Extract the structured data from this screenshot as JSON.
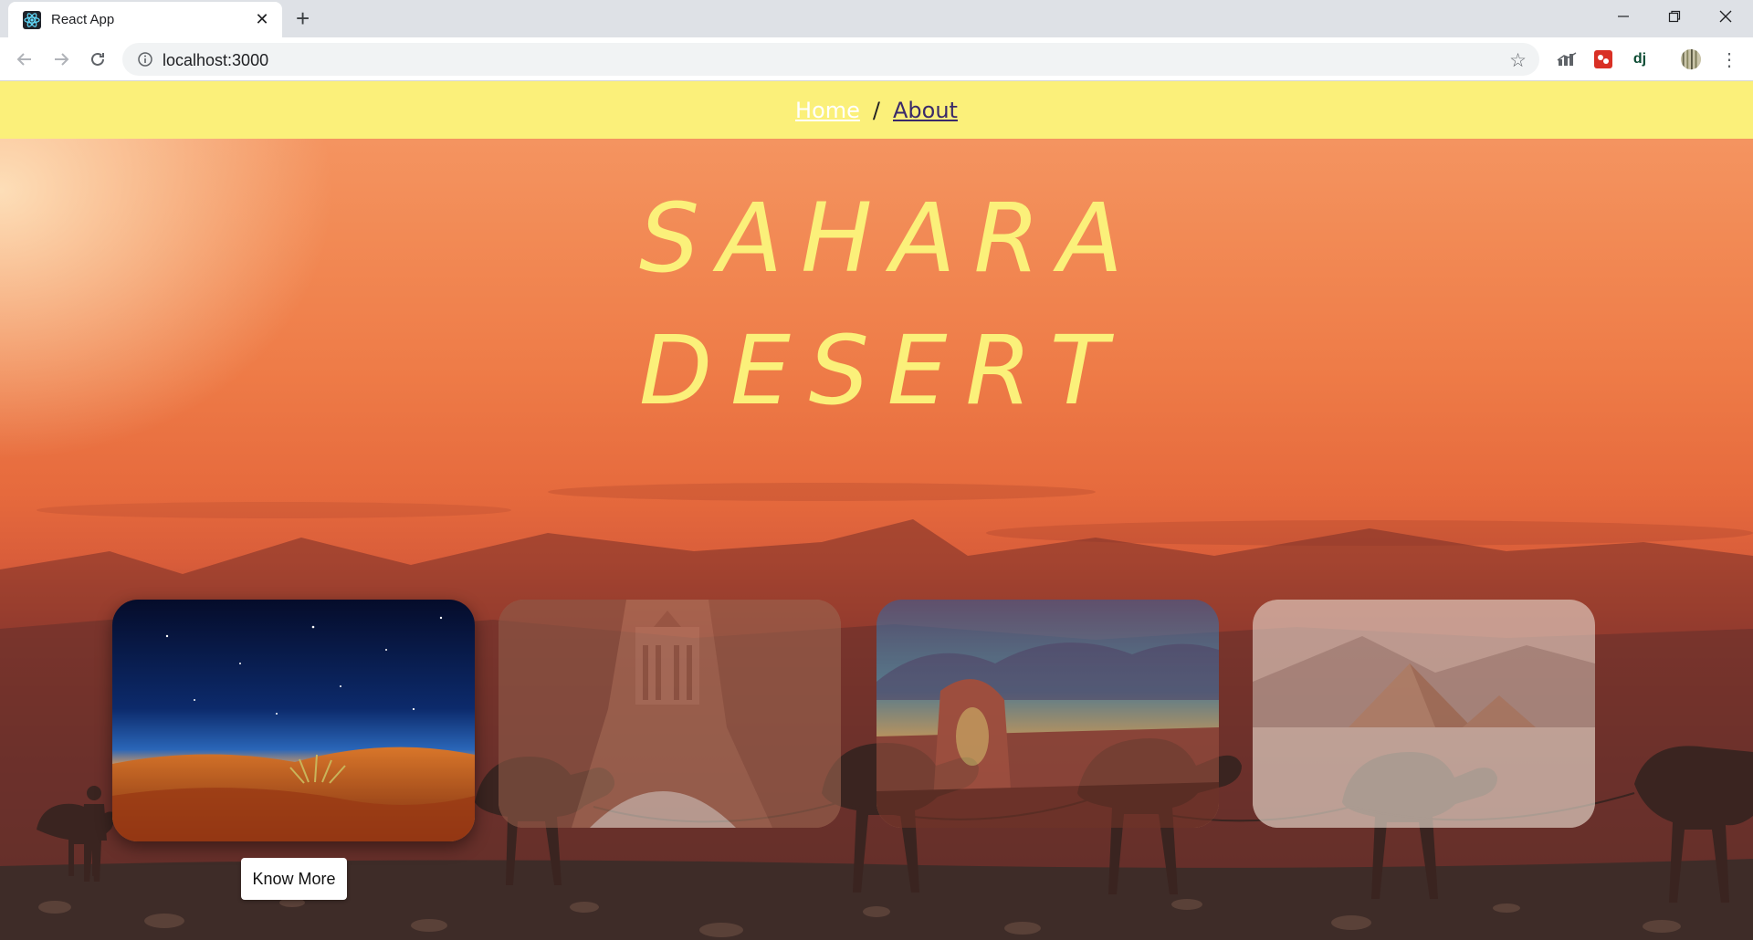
{
  "browser": {
    "tab_title": "React App",
    "url": "localhost:3000",
    "extension_dj_label": "dj"
  },
  "nav": {
    "home": "Home",
    "separator": "/",
    "about": "About"
  },
  "hero": {
    "line1": "SAHARA",
    "line2": "DESERT"
  },
  "cards": [
    {
      "name": "Desert dunes at night",
      "icon": "night-dunes"
    },
    {
      "name": "Petra treasury",
      "icon": "petra"
    },
    {
      "name": "Rock arch canyon",
      "icon": "rock-arch"
    },
    {
      "name": "Pyramids",
      "icon": "pyramids"
    }
  ],
  "button": {
    "know_more": "Know More"
  },
  "colors": {
    "accent_yellow": "#fbf07a",
    "tab_bar": "#dee1e6"
  }
}
